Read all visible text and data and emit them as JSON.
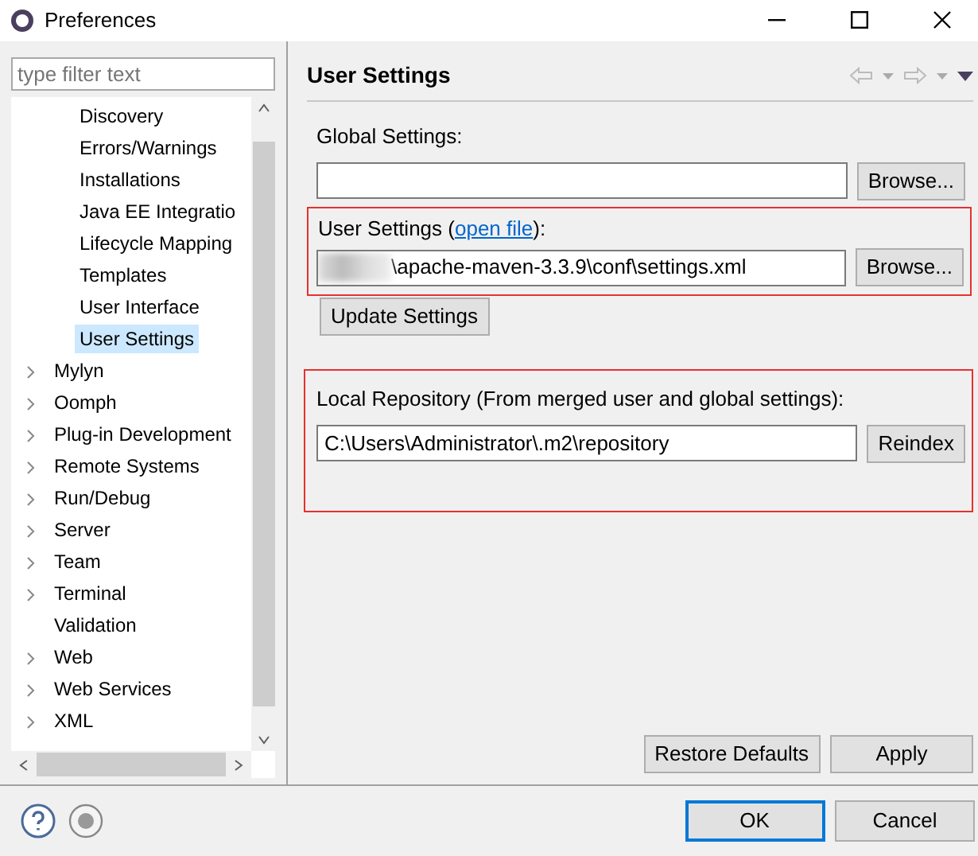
{
  "window": {
    "title": "Preferences"
  },
  "filter": {
    "placeholder": "type filter text"
  },
  "tree": {
    "items": [
      {
        "children": [
          {
            "label": "Discovery",
            "selected": false
          },
          {
            "label": "Errors/Warnings",
            "selected": false
          },
          {
            "label": "Installations",
            "selected": false
          },
          {
            "label": "Java EE Integratio",
            "selected": false
          },
          {
            "label": "Lifecycle Mapping",
            "selected": false
          },
          {
            "label": "Templates",
            "selected": false
          },
          {
            "label": "User Interface",
            "selected": false
          },
          {
            "label": "User Settings",
            "selected": true
          }
        ]
      },
      {
        "label": "Mylyn",
        "expandable": true,
        "selected": false
      },
      {
        "label": "Oomph",
        "expandable": true,
        "selected": false
      },
      {
        "label": "Plug-in Development",
        "expandable": true,
        "selected": false
      },
      {
        "label": "Remote Systems",
        "expandable": true,
        "selected": false
      },
      {
        "label": "Run/Debug",
        "expandable": true,
        "selected": false
      },
      {
        "label": "Server",
        "expandable": true,
        "selected": false
      },
      {
        "label": "Team",
        "expandable": true,
        "selected": false
      },
      {
        "label": "Terminal",
        "expandable": true,
        "selected": false
      },
      {
        "label": "Validation",
        "expandable": false,
        "selected": false
      },
      {
        "label": "Web",
        "expandable": true,
        "selected": false
      },
      {
        "label": "Web Services",
        "expandable": true,
        "selected": false
      },
      {
        "label": "XML",
        "expandable": true,
        "selected": false
      }
    ]
  },
  "page": {
    "title": "User Settings",
    "global_settings": {
      "label": "Global Settings:",
      "button": "Browse..."
    },
    "user_settings": {
      "label": "User Settings (",
      "link": "open file",
      "label_end": "):",
      "value": "\\apache-maven-3.3.9\\conf\\settings.xml",
      "value_blurred": true,
      "button": "Browse...",
      "highlighted": true
    },
    "update_button": "Update Settings",
    "local_repository": {
      "label": "Local Repository (From merged user and global settings):",
      "value": "C:\\Users\\Administrator\\.m2\\repository",
      "button": "Reindex",
      "highlighted": true
    },
    "buttons": [
      "Restore Defaults",
      "Apply"
    ]
  },
  "footer": {
    "buttons": [
      {
        "label": "OK",
        "default": true
      },
      {
        "label": "Cancel",
        "default": false
      }
    ]
  }
}
